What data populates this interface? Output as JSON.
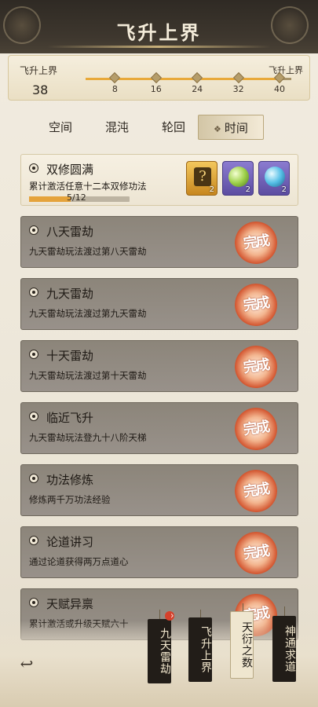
{
  "header": {
    "title": "飞升上界"
  },
  "progress": {
    "label_left": "飞升上界",
    "label_right": "飞升上界",
    "current": "38",
    "milestones": [
      "8",
      "16",
      "24",
      "32",
      "40"
    ],
    "fill_fraction": 0.95
  },
  "tabs": [
    {
      "label": "空间",
      "active": false
    },
    {
      "label": "混沌",
      "active": false
    },
    {
      "label": "轮回",
      "active": false
    },
    {
      "label": "时间",
      "active": true
    }
  ],
  "tab_marker": "❖",
  "quests": [
    {
      "title": "双修圆满",
      "desc": "累计激活任意十二本双修功法",
      "progress_text": "5/12",
      "progress_fraction": 0.417,
      "completed": false,
      "rewards": [
        {
          "icon": "golden-scroll-icon",
          "glyph": "?",
          "count": "2"
        },
        {
          "icon": "green-orb-icon",
          "count": "2"
        },
        {
          "icon": "blue-orb-icon",
          "count": "2"
        }
      ]
    },
    {
      "title": "八天雷劫",
      "desc": "九天雷劫玩法渡过第八天雷劫",
      "completed": true
    },
    {
      "title": "九天雷劫",
      "desc": "九天雷劫玩法渡过第九天雷劫",
      "completed": true
    },
    {
      "title": "十天雷劫",
      "desc": "九天雷劫玩法渡过第十天雷劫",
      "completed": true
    },
    {
      "title": "临近飞升",
      "desc": "九天雷劫玩法登九十八阶天梯",
      "completed": true
    },
    {
      "title": "功法修炼",
      "desc": "修炼两千万功法经验",
      "completed": true
    },
    {
      "title": "论道讲习",
      "desc": "通过论道获得两万点道心",
      "completed": true
    },
    {
      "title": "天赋异禀",
      "desc": "累计激活或升级天赋六十",
      "completed": true
    }
  ],
  "completed_seal": "完成",
  "bottom_tags": [
    {
      "label": "九天雷劫",
      "has_badge": true,
      "badge": "^"
    },
    {
      "label": "飞升上界",
      "has_badge": false
    },
    {
      "label": "天衍之数",
      "has_badge": false,
      "active": true
    },
    {
      "label": "神通求道",
      "has_badge": false
    }
  ],
  "back_glyph": "↩"
}
